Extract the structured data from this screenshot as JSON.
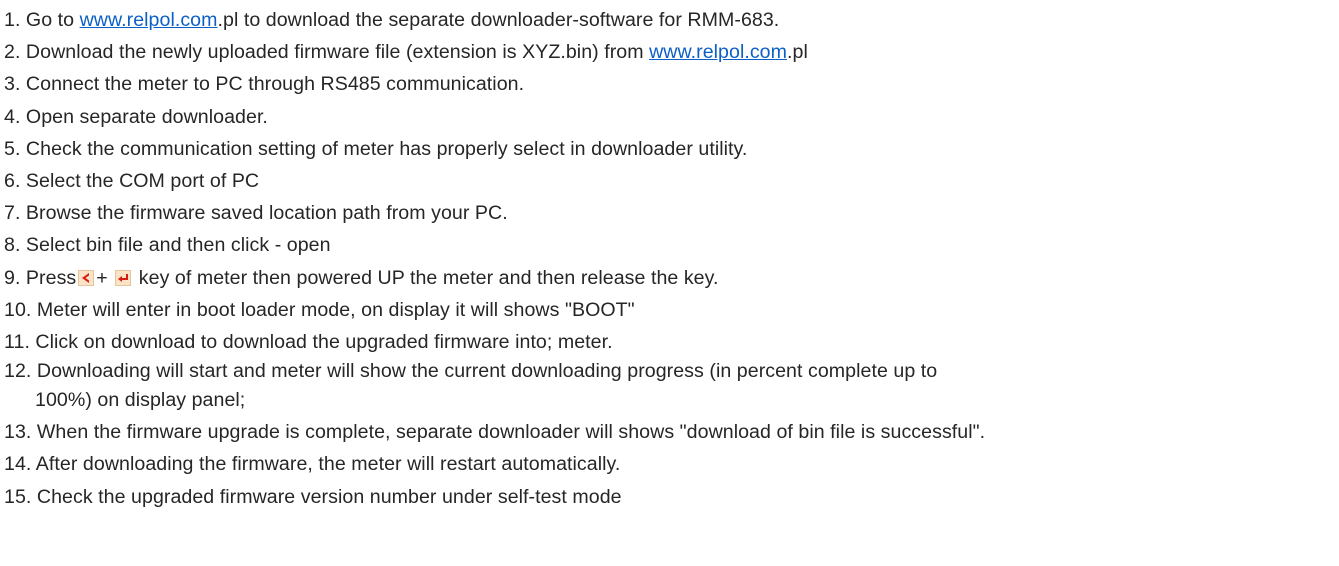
{
  "colors": {
    "text": "#262626",
    "link": "#0b5fc6",
    "key_background": "#fbe3c8",
    "key_symbol": "#d81e10"
  },
  "steps": {
    "s1": {
      "a": "1. Go to ",
      "link": "www.relpol.com",
      "b": ".pl to download the separate downloader-software for RMM-683."
    },
    "s2": {
      "a": "2. Download the newly uploaded firmware file (extension is XYZ.bin) from ",
      "link": "www.relpol.com",
      "b": ".pl"
    },
    "s3": "3. Connect the meter to PC through RS485 communication.",
    "s4": "4. Open separate downloader.",
    "s5": "5. Check the communication setting of meter has properly select in downloader utility.",
    "s6": "6. Select the COM port of PC",
    "s7": "7. Browse the firmware saved location path from your PC.",
    "s8": "8. Select bin file and then click - open",
    "s9": {
      "a": "9. Press",
      "key_left_icon": "left-arrow-key-icon",
      "plus": "+ ",
      "key_enter_icon": "enter-key-icon",
      "b": " key of meter then powered UP the meter and then release the key."
    },
    "s10": "10. Meter will enter in boot loader mode, on display it will shows \"BOOT\"",
    "s11": "11. Click on download to download the upgraded firmware into; meter.",
    "s12": {
      "line1": "12. Downloading will start and meter will show the current downloading progress (in percent complete up to",
      "line2": "100%) on display panel;"
    },
    "s13": "13. When the firmware upgrade is complete, separate downloader will shows \"download of bin file is successful\".",
    "s14": "14. After downloading the firmware, the meter will restart automatically.",
    "s15": "15. Check the upgraded firmware version number under self-test mode"
  }
}
